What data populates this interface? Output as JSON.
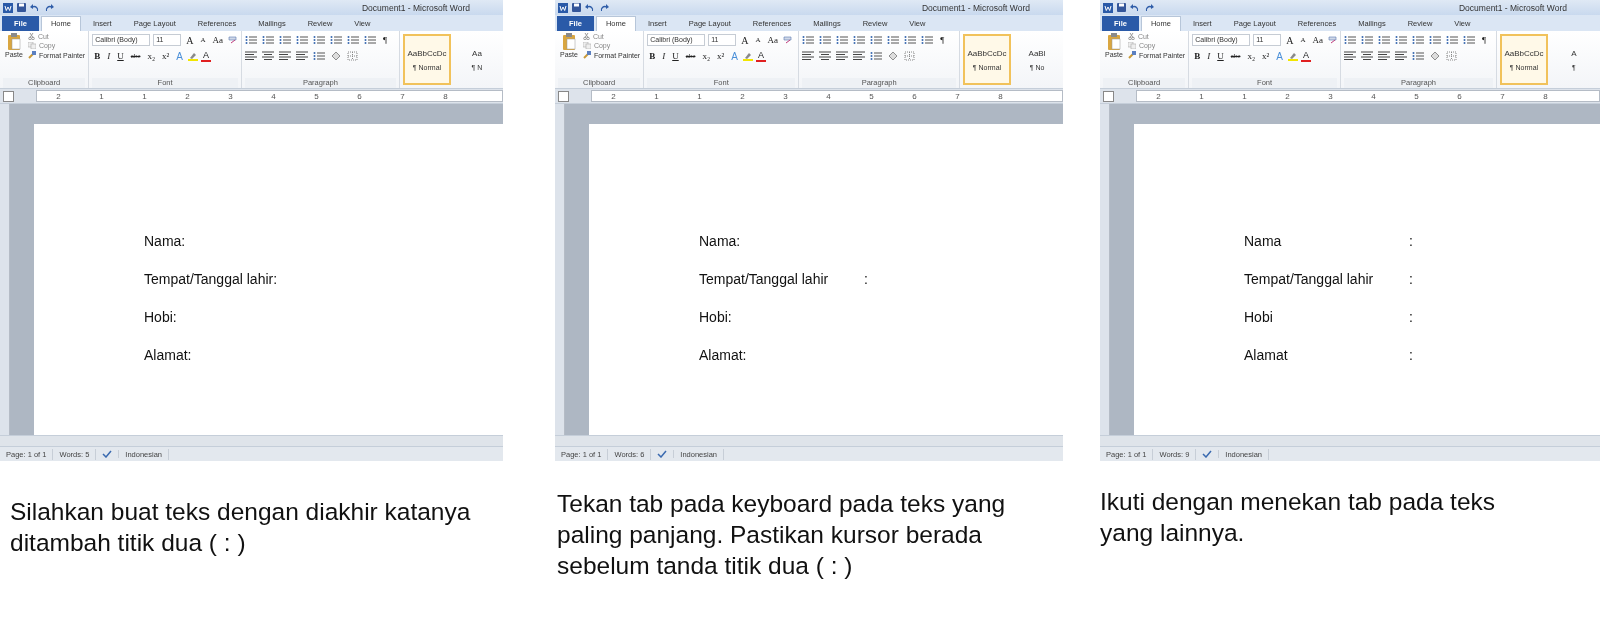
{
  "panels": [
    {
      "title_bar": {
        "title": "Document1 - Microsoft Word"
      },
      "tabs": [
        {
          "label": "File",
          "kind": "file",
          "selected": false
        },
        {
          "label": "Home",
          "kind": "tab",
          "selected": true
        },
        {
          "label": "Insert",
          "kind": "tab",
          "selected": false
        },
        {
          "label": "Page Layout",
          "kind": "tab",
          "selected": false
        },
        {
          "label": "References",
          "kind": "tab",
          "selected": false
        },
        {
          "label": "Mailings",
          "kind": "tab",
          "selected": false
        },
        {
          "label": "Review",
          "kind": "tab",
          "selected": false
        },
        {
          "label": "View",
          "kind": "tab",
          "selected": false
        }
      ],
      "clipboard": {
        "paste": "Paste",
        "cut": "Cut",
        "copy": "Copy",
        "format_painter": "Format Painter",
        "label": "Clipboard"
      },
      "font": {
        "name": "Calibri (Body)",
        "size": "11",
        "grow": "A",
        "shrink": "A",
        "change_case": "Aa",
        "label": "Font",
        "buttons": [
          {
            "label": "B",
            "kind": "bold"
          },
          {
            "label": "I",
            "kind": "italic"
          },
          {
            "label": "U",
            "kind": "underline"
          },
          {
            "label": "abc",
            "kind": "strike"
          },
          {
            "label": "x₂",
            "kind": "plain"
          },
          {
            "label": "x²",
            "kind": "plain"
          },
          {
            "label": "A",
            "kind": "effects"
          },
          {
            "label": "A",
            "kind": "color"
          }
        ]
      },
      "paragraph": {
        "label": "Paragraph",
        "marks": "¶"
      },
      "styles": [
        {
          "preview": "AaBbCcDc",
          "name": "¶ Normal",
          "selected": true
        },
        {
          "preview": "Aa",
          "name": "¶ N",
          "selected": false
        }
      ],
      "ruler": [
        "2",
        "1",
        "1",
        "2",
        "3",
        "4",
        "5",
        "6",
        "7",
        "8"
      ],
      "document": {
        "lines": [
          {
            "text": "Nama:"
          },
          {
            "text": "Tempat/Tanggal lahir:"
          },
          {
            "text": "Hobi:"
          },
          {
            "text": "Alamat:"
          }
        ]
      },
      "status_bar": {
        "page": "Page: 1 of 1",
        "words": "Words: 5",
        "language": "Indonesian"
      },
      "caption": "Silahkan buat teks dengan diakhir katanya ditambah titik dua ( : )"
    },
    {
      "title_bar": {
        "title": "Document1 - Microsoft Word"
      },
      "tabs": [
        {
          "label": "File",
          "kind": "file",
          "selected": false
        },
        {
          "label": "Home",
          "kind": "tab",
          "selected": true
        },
        {
          "label": "Insert",
          "kind": "tab",
          "selected": false
        },
        {
          "label": "Page Layout",
          "kind": "tab",
          "selected": false
        },
        {
          "label": "References",
          "kind": "tab",
          "selected": false
        },
        {
          "label": "Mailings",
          "kind": "tab",
          "selected": false
        },
        {
          "label": "Review",
          "kind": "tab",
          "selected": false
        },
        {
          "label": "View",
          "kind": "tab",
          "selected": false
        }
      ],
      "clipboard": {
        "paste": "Paste",
        "cut": "Cut",
        "copy": "Copy",
        "format_painter": "Format Painter",
        "label": "Clipboard"
      },
      "font": {
        "name": "Calibri (Body)",
        "size": "11",
        "grow": "A",
        "shrink": "A",
        "change_case": "Aa",
        "label": "Font",
        "buttons": [
          {
            "label": "B",
            "kind": "bold"
          },
          {
            "label": "I",
            "kind": "italic"
          },
          {
            "label": "U",
            "kind": "underline"
          },
          {
            "label": "abc",
            "kind": "strike"
          },
          {
            "label": "x₂",
            "kind": "plain"
          },
          {
            "label": "x²",
            "kind": "plain"
          },
          {
            "label": "A",
            "kind": "effects"
          },
          {
            "label": "A",
            "kind": "color"
          }
        ]
      },
      "paragraph": {
        "label": "Paragraph",
        "marks": "¶"
      },
      "styles": [
        {
          "preview": "AaBbCcDc",
          "name": "¶ Normal",
          "selected": true
        },
        {
          "preview": "AaBl",
          "name": "¶ No",
          "selected": false
        }
      ],
      "ruler": [
        "2",
        "1",
        "1",
        "2",
        "3",
        "4",
        "5",
        "6",
        "7",
        "8"
      ],
      "document": {
        "lines": [
          {
            "text": "Nama:"
          },
          {
            "text": "Tempat/Tanggal lahir",
            "tab_text": ":"
          },
          {
            "text": "Hobi:"
          },
          {
            "text": "Alamat:"
          }
        ]
      },
      "status_bar": {
        "page": "Page: 1 of 1",
        "words": "Words: 6",
        "language": "Indonesian"
      },
      "caption": "Tekan tab pada keyboard pada teks yang paling panjang. Pastikan kursor berada sebelum tanda titik dua ( : )"
    },
    {
      "title_bar": {
        "title": "Document1 - Microsoft Word"
      },
      "tabs": [
        {
          "label": "File",
          "kind": "file",
          "selected": false
        },
        {
          "label": "Home",
          "kind": "tab",
          "selected": true
        },
        {
          "label": "Insert",
          "kind": "tab",
          "selected": false
        },
        {
          "label": "Page Layout",
          "kind": "tab",
          "selected": false
        },
        {
          "label": "References",
          "kind": "tab",
          "selected": false
        },
        {
          "label": "Mailings",
          "kind": "tab",
          "selected": false
        },
        {
          "label": "Review",
          "kind": "tab",
          "selected": false
        },
        {
          "label": "View",
          "kind": "tab",
          "selected": false
        }
      ],
      "clipboard": {
        "paste": "Paste",
        "cut": "Cut",
        "copy": "Copy",
        "format_painter": "Format Painter",
        "label": "Clipboard"
      },
      "font": {
        "name": "Calibri (Body)",
        "size": "11",
        "grow": "A",
        "shrink": "A",
        "change_case": "Aa",
        "label": "Font",
        "buttons": [
          {
            "label": "B",
            "kind": "bold"
          },
          {
            "label": "I",
            "kind": "italic"
          },
          {
            "label": "U",
            "kind": "underline"
          },
          {
            "label": "abc",
            "kind": "strike"
          },
          {
            "label": "x₂",
            "kind": "plain"
          },
          {
            "label": "x²",
            "kind": "plain"
          },
          {
            "label": "A",
            "kind": "effects"
          },
          {
            "label": "A",
            "kind": "color"
          }
        ]
      },
      "paragraph": {
        "label": "Paragraph",
        "marks": "¶"
      },
      "styles": [
        {
          "preview": "AaBbCcDc",
          "name": "¶ Normal",
          "selected": true
        },
        {
          "preview": "A",
          "name": "¶",
          "selected": false
        }
      ],
      "ruler": [
        "2",
        "1",
        "1",
        "2",
        "3",
        "4",
        "5",
        "6",
        "7",
        "8"
      ],
      "document": {
        "lines": [
          {
            "text": "Nama",
            "tab_text": ":"
          },
          {
            "text": "Tempat/Tanggal lahir",
            "tab_text": ":"
          },
          {
            "text": "Hobi",
            "tab_text": ":"
          },
          {
            "text": "Alamat",
            "tab_text": ":"
          }
        ]
      },
      "status_bar": {
        "page": "Page: 1 of 1",
        "words": "Words: 9",
        "language": "Indonesian"
      },
      "caption": "Ikuti dengan menekan tab pada teks yang lainnya."
    }
  ]
}
